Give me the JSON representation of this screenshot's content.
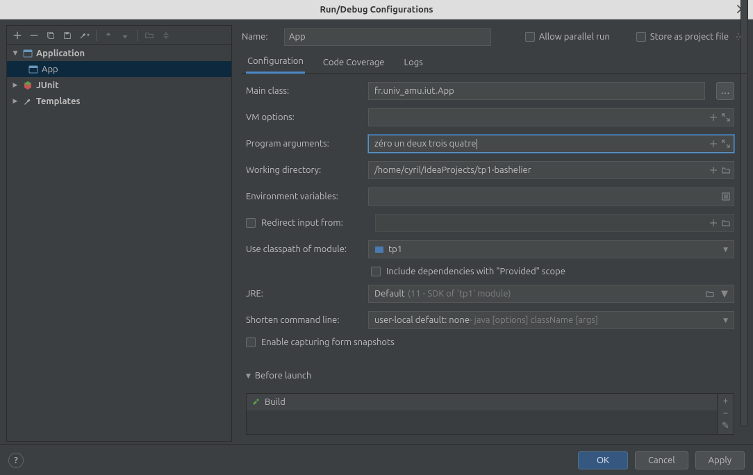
{
  "window": {
    "title": "Run/Debug Configurations"
  },
  "sidebar": {
    "items": [
      {
        "label": "Application",
        "expanded": true,
        "bold": true
      },
      {
        "label": "App",
        "child": true,
        "selected": true
      },
      {
        "label": "JUnit",
        "expanded": false,
        "bold": true
      },
      {
        "label": "Templates",
        "expanded": false,
        "bold": true
      }
    ]
  },
  "header": {
    "name_label": "Name:",
    "name_value": "App",
    "allow_parallel": "Allow parallel run",
    "store_as_file": "Store as project file"
  },
  "tabs": [
    "Configuration",
    "Code Coverage",
    "Logs"
  ],
  "active_tab": 0,
  "form": {
    "main_class": {
      "label": "Main class:",
      "value": "fr.univ_amu.iut.App"
    },
    "vm_options": {
      "label": "VM options:",
      "value": ""
    },
    "program_args": {
      "label": "Program arguments:",
      "value": "zéro un deux trois quatre"
    },
    "workdir": {
      "label": "Working directory:",
      "value": "/home/cyril/IdeaProjects/tp1-bashelier"
    },
    "env": {
      "label": "Environment variables:",
      "value": ""
    },
    "redirect": {
      "label": "Redirect input from:",
      "value": ""
    },
    "classpath": {
      "label": "Use classpath of module:",
      "value": "tp1"
    },
    "include_provided": "Include dependencies with \"Provided\" scope",
    "jre": {
      "label": "JRE:",
      "value": "Default",
      "hint": "(11 - SDK of 'tp1' module)"
    },
    "shorten": {
      "label": "Shorten command line:",
      "value": "user-local default: none",
      "hint": " - java [options] className [args]"
    },
    "enable_snapshots": "Enable capturing form snapshots"
  },
  "before_launch": {
    "title": "Before launch",
    "items": [
      "Build"
    ]
  },
  "buttons": {
    "ok": "OK",
    "cancel": "Cancel",
    "apply": "Apply"
  }
}
